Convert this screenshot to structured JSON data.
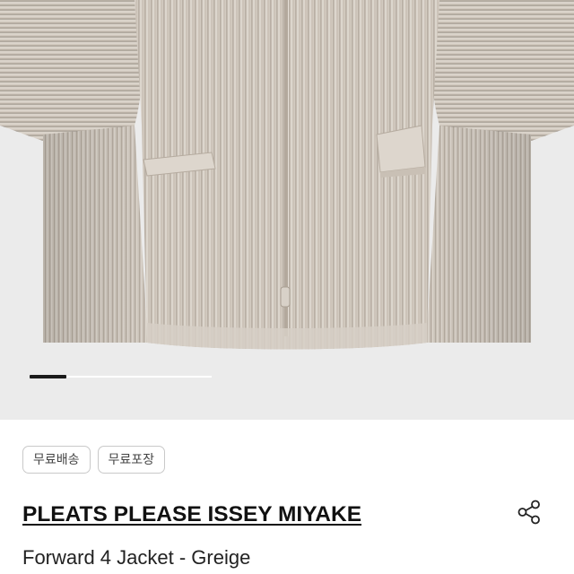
{
  "carousel": {
    "image_alt": "Forward 4 Jacket - Greige",
    "position_fraction": 0.2
  },
  "badges": [
    {
      "label": "무료배송"
    },
    {
      "label": "무료포장"
    }
  ],
  "product": {
    "brand": "PLEATS PLEASE ISSEY MIYAKE",
    "name": "Forward 4 Jacket - Greige"
  },
  "icons": {
    "share": "share-icon"
  },
  "colors": {
    "image_background": "#ebebeb",
    "fabric": "#cfc7bd",
    "indicator_active": "#1a1a1a",
    "badge_border": "#c9c9c9"
  }
}
